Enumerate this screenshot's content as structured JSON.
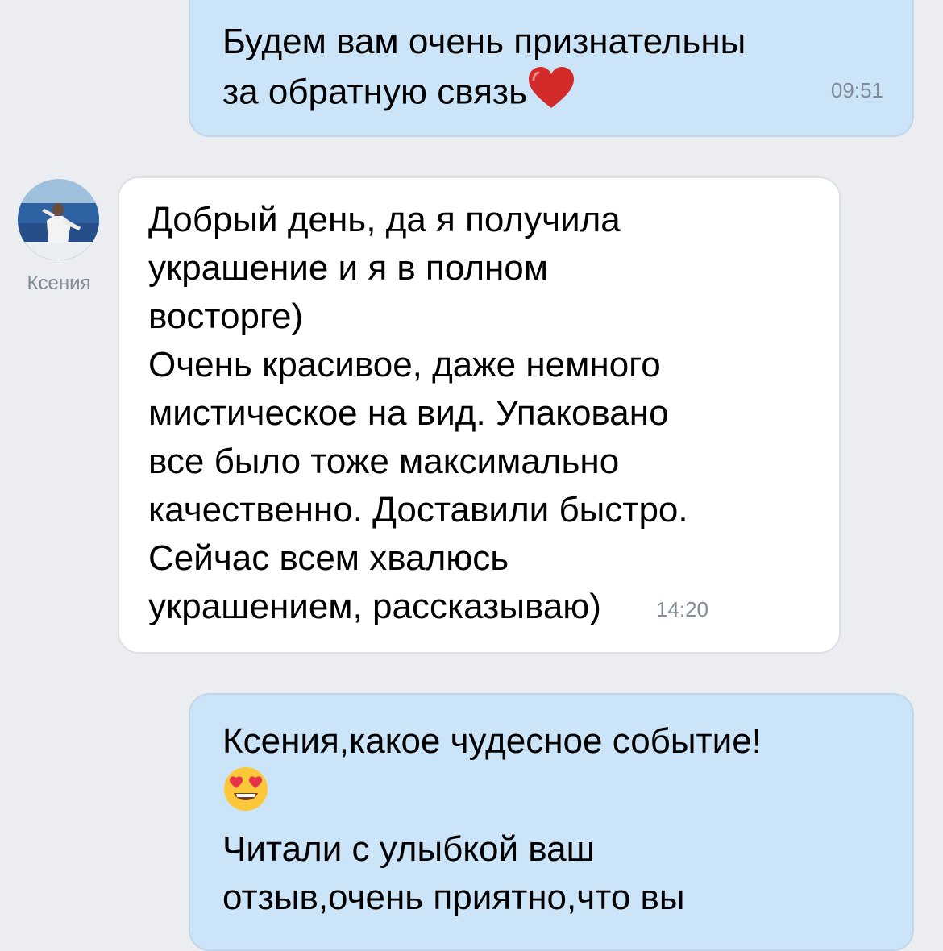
{
  "chat": {
    "messages": [
      {
        "direction": "outgoing",
        "lines": [
          "Будем вам очень признательны",
          "за обратную связь"
        ],
        "emoji": "heart-emoji",
        "time": "09:51"
      },
      {
        "direction": "incoming",
        "sender": "Ксения",
        "lines": [
          "Добрый день, да я получила",
          "украшение и я в полном",
          "восторге)",
          "Очень красивое, даже немного",
          "мистическое на вид. Упаковано",
          "все было тоже максимально",
          "качественно. Доставили быстро.",
          "Сейчас всем хвалюсь",
          "украшением, рассказываю)"
        ],
        "time": "14:20"
      },
      {
        "direction": "outgoing",
        "lines": [
          "Ксения,какое чудесное событие!",
          "Читали с улыбкой ваш",
          "отзыв,очень приятно,что вы"
        ],
        "emoji": "heart-eyes-emoji"
      }
    ]
  },
  "colors": {
    "background": "#ebedf0",
    "outgoing_bubble": "#cce4f7",
    "incoming_bubble": "#ffffff",
    "time_text": "#818c99"
  }
}
